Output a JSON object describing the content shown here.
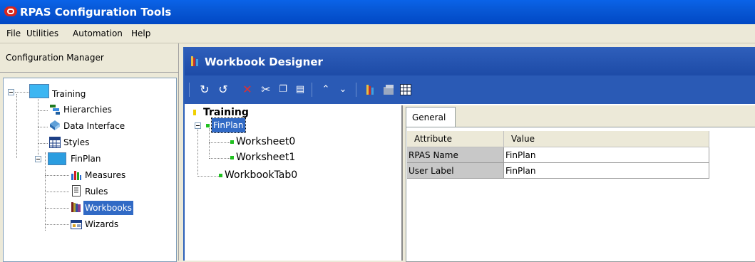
{
  "window": {
    "title": "RPAS Configuration Tools",
    "accent": "#0a5fe0"
  },
  "menu": [
    {
      "label": "File"
    },
    {
      "label": "Utilities"
    },
    {
      "label": "Automation"
    },
    {
      "label": "Help"
    }
  ],
  "config_manager": {
    "title": "Configuration Manager",
    "tree": {
      "root": "Training",
      "items": {
        "hierarchies": "Hierarchies",
        "data_interface": "Data Interface",
        "styles": "Styles",
        "finplan": "FinPlan",
        "measures": "Measures",
        "rules": "Rules",
        "workbooks": "Workbooks",
        "wizards": "Wizards"
      },
      "selected": "Workbooks"
    }
  },
  "workbook_designer": {
    "title": "Workbook Designer",
    "toolbar_icons": [
      "redo-icon",
      "refresh-icon",
      "delete-icon",
      "cut-icon",
      "copy-icon",
      "paste-icon",
      "move-up-icon",
      "move-down-icon",
      "workbook-icon",
      "worksheet-icon",
      "grid-icon"
    ],
    "tree": {
      "root": "Training",
      "template": "FinPlan",
      "worksheet0": "Worksheet0",
      "worksheet1": "Worksheet1",
      "tab": "WorkbookTab0"
    },
    "properties": {
      "tab": "General",
      "columns": [
        "Attribute",
        "Value"
      ],
      "rows": [
        {
          "attribute": "RPAS Name",
          "value": "FinPlan"
        },
        {
          "attribute": "User Label",
          "value": "FinPlan"
        }
      ]
    }
  }
}
